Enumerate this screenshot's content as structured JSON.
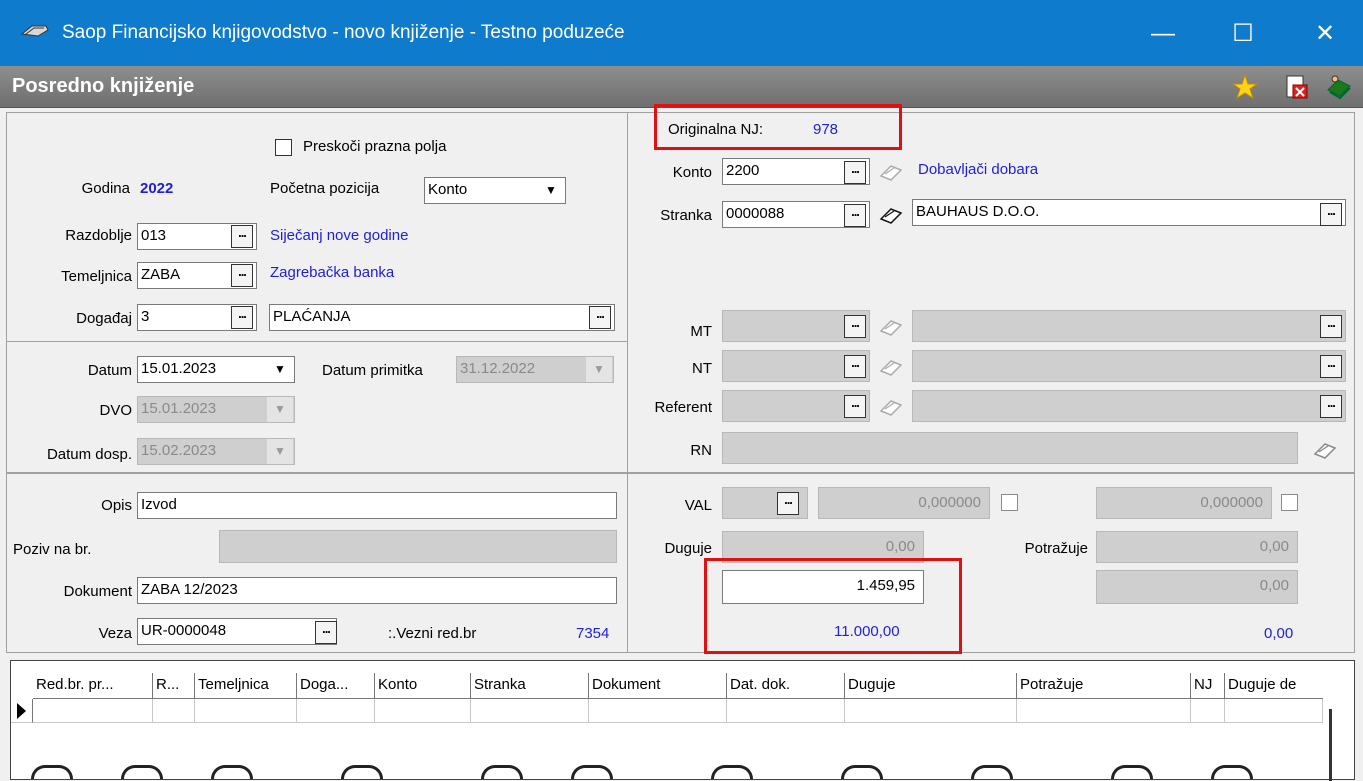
{
  "window": {
    "title": "Saop Financijsko knjigovodstvo - novo knjiženje - Testno poduzeće",
    "minimize": "—",
    "maximize": "☐",
    "close": "✕"
  },
  "header": {
    "title": "Posredno knjiženje"
  },
  "left": {
    "skip_empty_label": "Preskoči prazna polja",
    "year_label": "Godina",
    "year_value": "2022",
    "start_pos_label": "Početna pozicija",
    "start_pos_value": "Konto",
    "period_label": "Razdoblje",
    "period_value": "013",
    "period_desc": "Siječanj nove godine",
    "ledger_label": "Temeljnica",
    "ledger_value": "ZABA",
    "ledger_desc": "Zagrebačka banka",
    "event_label": "Događaj",
    "event_value": "3",
    "event_desc": "PLAĆANJA",
    "date_label": "Datum",
    "date_value": "15.01.2023",
    "date_received_label": "Datum primitka",
    "date_received_value": "31.12.2022",
    "dvo_label": "DVO",
    "dvo_value": "15.01.2023",
    "due_label": "Datum dosp.",
    "due_value": "15.02.2023",
    "desc_label": "Opis",
    "desc_value": "Izvod",
    "ref_label": "Poziv na br.",
    "ref_value": "",
    "doc_label": "Dokument",
    "doc_value": "ZABA 12/2023",
    "link_label": "Veza",
    "link_value": "UR-0000048",
    "linked_row_label": ":.Vezni red.br",
    "linked_row_value": "7354"
  },
  "right": {
    "orig_nj_label": "Originalna NJ:",
    "orig_nj_value": "978",
    "account_label": "Konto",
    "account_value": "2200",
    "account_desc": "Dobavljači dobara",
    "partner_label": "Stranka",
    "partner_value": "0000088",
    "partner_name": "BAUHAUS D.O.O.",
    "mt_label": "MT",
    "nt_label": "NT",
    "referent_label": "Referent",
    "rn_label": "RN",
    "val_label": "VAL",
    "val_rate1": "0,000000",
    "val_rate2": "0,000000",
    "debit_label": "Duguje",
    "debit_value": "0,00",
    "credit_label": "Potražuje",
    "credit_value": "0,00",
    "amount_input": "1.459,95",
    "credit_input": "0,00",
    "debit_total": "11.000,00",
    "credit_total": "0,00"
  },
  "grid": {
    "columns": [
      "Red.br. pr...",
      "R...",
      "Temeljnica",
      "Doga...",
      "Konto",
      "Stranka",
      "Dokument",
      "Dat. dok.",
      "Duguje",
      "Potražuje",
      "NJ",
      "Duguje de"
    ]
  }
}
